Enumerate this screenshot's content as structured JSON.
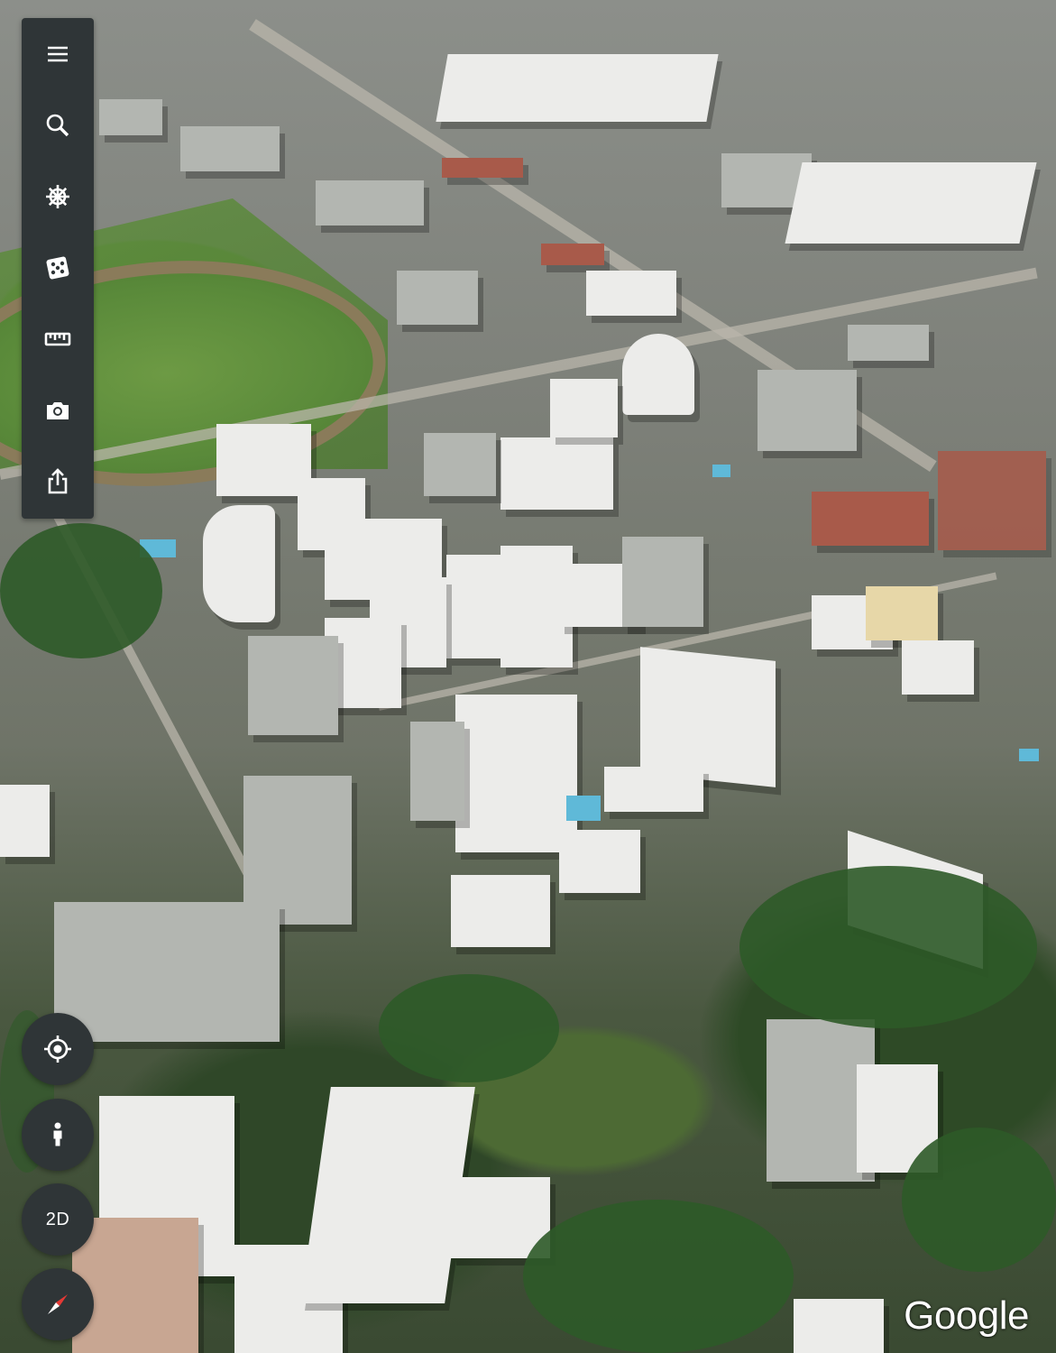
{
  "toolbar": {
    "items": [
      {
        "name": "menu",
        "icon": "hamburger-menu-icon"
      },
      {
        "name": "search",
        "icon": "search-icon"
      },
      {
        "name": "voyager",
        "icon": "ship-wheel-icon"
      },
      {
        "name": "feeling-lucky",
        "icon": "dice-icon"
      },
      {
        "name": "measure",
        "icon": "ruler-icon"
      },
      {
        "name": "capture",
        "icon": "camera-icon"
      },
      {
        "name": "share",
        "icon": "share-icon"
      }
    ]
  },
  "controls": {
    "my_location_icon": "crosshair-icon",
    "street_view_icon": "pegman-icon",
    "view_toggle_label": "2D",
    "compass_icon": "compass-icon"
  },
  "branding": {
    "logo_text": "Google"
  },
  "colors": {
    "panel": "#2f3537",
    "icon": "#ffffff",
    "compass_red": "#e53935"
  }
}
